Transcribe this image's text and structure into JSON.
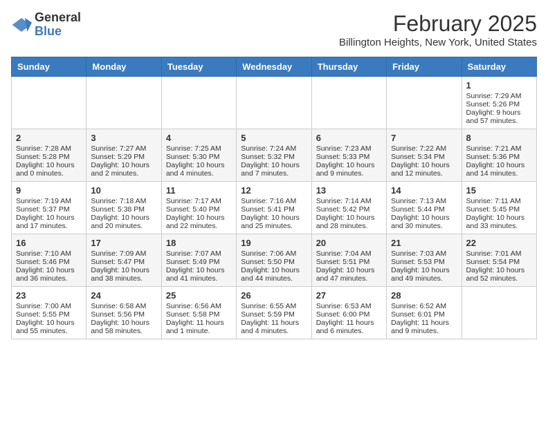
{
  "header": {
    "logo_general": "General",
    "logo_blue": "Blue",
    "month_title": "February 2025",
    "subtitle": "Billington Heights, New York, United States"
  },
  "weekdays": [
    "Sunday",
    "Monday",
    "Tuesday",
    "Wednesday",
    "Thursday",
    "Friday",
    "Saturday"
  ],
  "weeks": [
    [
      {
        "day": "",
        "text": ""
      },
      {
        "day": "",
        "text": ""
      },
      {
        "day": "",
        "text": ""
      },
      {
        "day": "",
        "text": ""
      },
      {
        "day": "",
        "text": ""
      },
      {
        "day": "",
        "text": ""
      },
      {
        "day": "1",
        "text": "Sunrise: 7:29 AM\nSunset: 5:26 PM\nDaylight: 9 hours and 57 minutes."
      }
    ],
    [
      {
        "day": "2",
        "text": "Sunrise: 7:28 AM\nSunset: 5:28 PM\nDaylight: 10 hours and 0 minutes."
      },
      {
        "day": "3",
        "text": "Sunrise: 7:27 AM\nSunset: 5:29 PM\nDaylight: 10 hours and 2 minutes."
      },
      {
        "day": "4",
        "text": "Sunrise: 7:25 AM\nSunset: 5:30 PM\nDaylight: 10 hours and 4 minutes."
      },
      {
        "day": "5",
        "text": "Sunrise: 7:24 AM\nSunset: 5:32 PM\nDaylight: 10 hours and 7 minutes."
      },
      {
        "day": "6",
        "text": "Sunrise: 7:23 AM\nSunset: 5:33 PM\nDaylight: 10 hours and 9 minutes."
      },
      {
        "day": "7",
        "text": "Sunrise: 7:22 AM\nSunset: 5:34 PM\nDaylight: 10 hours and 12 minutes."
      },
      {
        "day": "8",
        "text": "Sunrise: 7:21 AM\nSunset: 5:36 PM\nDaylight: 10 hours and 14 minutes."
      }
    ],
    [
      {
        "day": "9",
        "text": "Sunrise: 7:19 AM\nSunset: 5:37 PM\nDaylight: 10 hours and 17 minutes."
      },
      {
        "day": "10",
        "text": "Sunrise: 7:18 AM\nSunset: 5:38 PM\nDaylight: 10 hours and 20 minutes."
      },
      {
        "day": "11",
        "text": "Sunrise: 7:17 AM\nSunset: 5:40 PM\nDaylight: 10 hours and 22 minutes."
      },
      {
        "day": "12",
        "text": "Sunrise: 7:16 AM\nSunset: 5:41 PM\nDaylight: 10 hours and 25 minutes."
      },
      {
        "day": "13",
        "text": "Sunrise: 7:14 AM\nSunset: 5:42 PM\nDaylight: 10 hours and 28 minutes."
      },
      {
        "day": "14",
        "text": "Sunrise: 7:13 AM\nSunset: 5:44 PM\nDaylight: 10 hours and 30 minutes."
      },
      {
        "day": "15",
        "text": "Sunrise: 7:11 AM\nSunset: 5:45 PM\nDaylight: 10 hours and 33 minutes."
      }
    ],
    [
      {
        "day": "16",
        "text": "Sunrise: 7:10 AM\nSunset: 5:46 PM\nDaylight: 10 hours and 36 minutes."
      },
      {
        "day": "17",
        "text": "Sunrise: 7:09 AM\nSunset: 5:47 PM\nDaylight: 10 hours and 38 minutes."
      },
      {
        "day": "18",
        "text": "Sunrise: 7:07 AM\nSunset: 5:49 PM\nDaylight: 10 hours and 41 minutes."
      },
      {
        "day": "19",
        "text": "Sunrise: 7:06 AM\nSunset: 5:50 PM\nDaylight: 10 hours and 44 minutes."
      },
      {
        "day": "20",
        "text": "Sunrise: 7:04 AM\nSunset: 5:51 PM\nDaylight: 10 hours and 47 minutes."
      },
      {
        "day": "21",
        "text": "Sunrise: 7:03 AM\nSunset: 5:53 PM\nDaylight: 10 hours and 49 minutes."
      },
      {
        "day": "22",
        "text": "Sunrise: 7:01 AM\nSunset: 5:54 PM\nDaylight: 10 hours and 52 minutes."
      }
    ],
    [
      {
        "day": "23",
        "text": "Sunrise: 7:00 AM\nSunset: 5:55 PM\nDaylight: 10 hours and 55 minutes."
      },
      {
        "day": "24",
        "text": "Sunrise: 6:58 AM\nSunset: 5:56 PM\nDaylight: 10 hours and 58 minutes."
      },
      {
        "day": "25",
        "text": "Sunrise: 6:56 AM\nSunset: 5:58 PM\nDaylight: 11 hours and 1 minute."
      },
      {
        "day": "26",
        "text": "Sunrise: 6:55 AM\nSunset: 5:59 PM\nDaylight: 11 hours and 4 minutes."
      },
      {
        "day": "27",
        "text": "Sunrise: 6:53 AM\nSunset: 6:00 PM\nDaylight: 11 hours and 6 minutes."
      },
      {
        "day": "28",
        "text": "Sunrise: 6:52 AM\nSunset: 6:01 PM\nDaylight: 11 hours and 9 minutes."
      },
      {
        "day": "",
        "text": ""
      }
    ]
  ]
}
